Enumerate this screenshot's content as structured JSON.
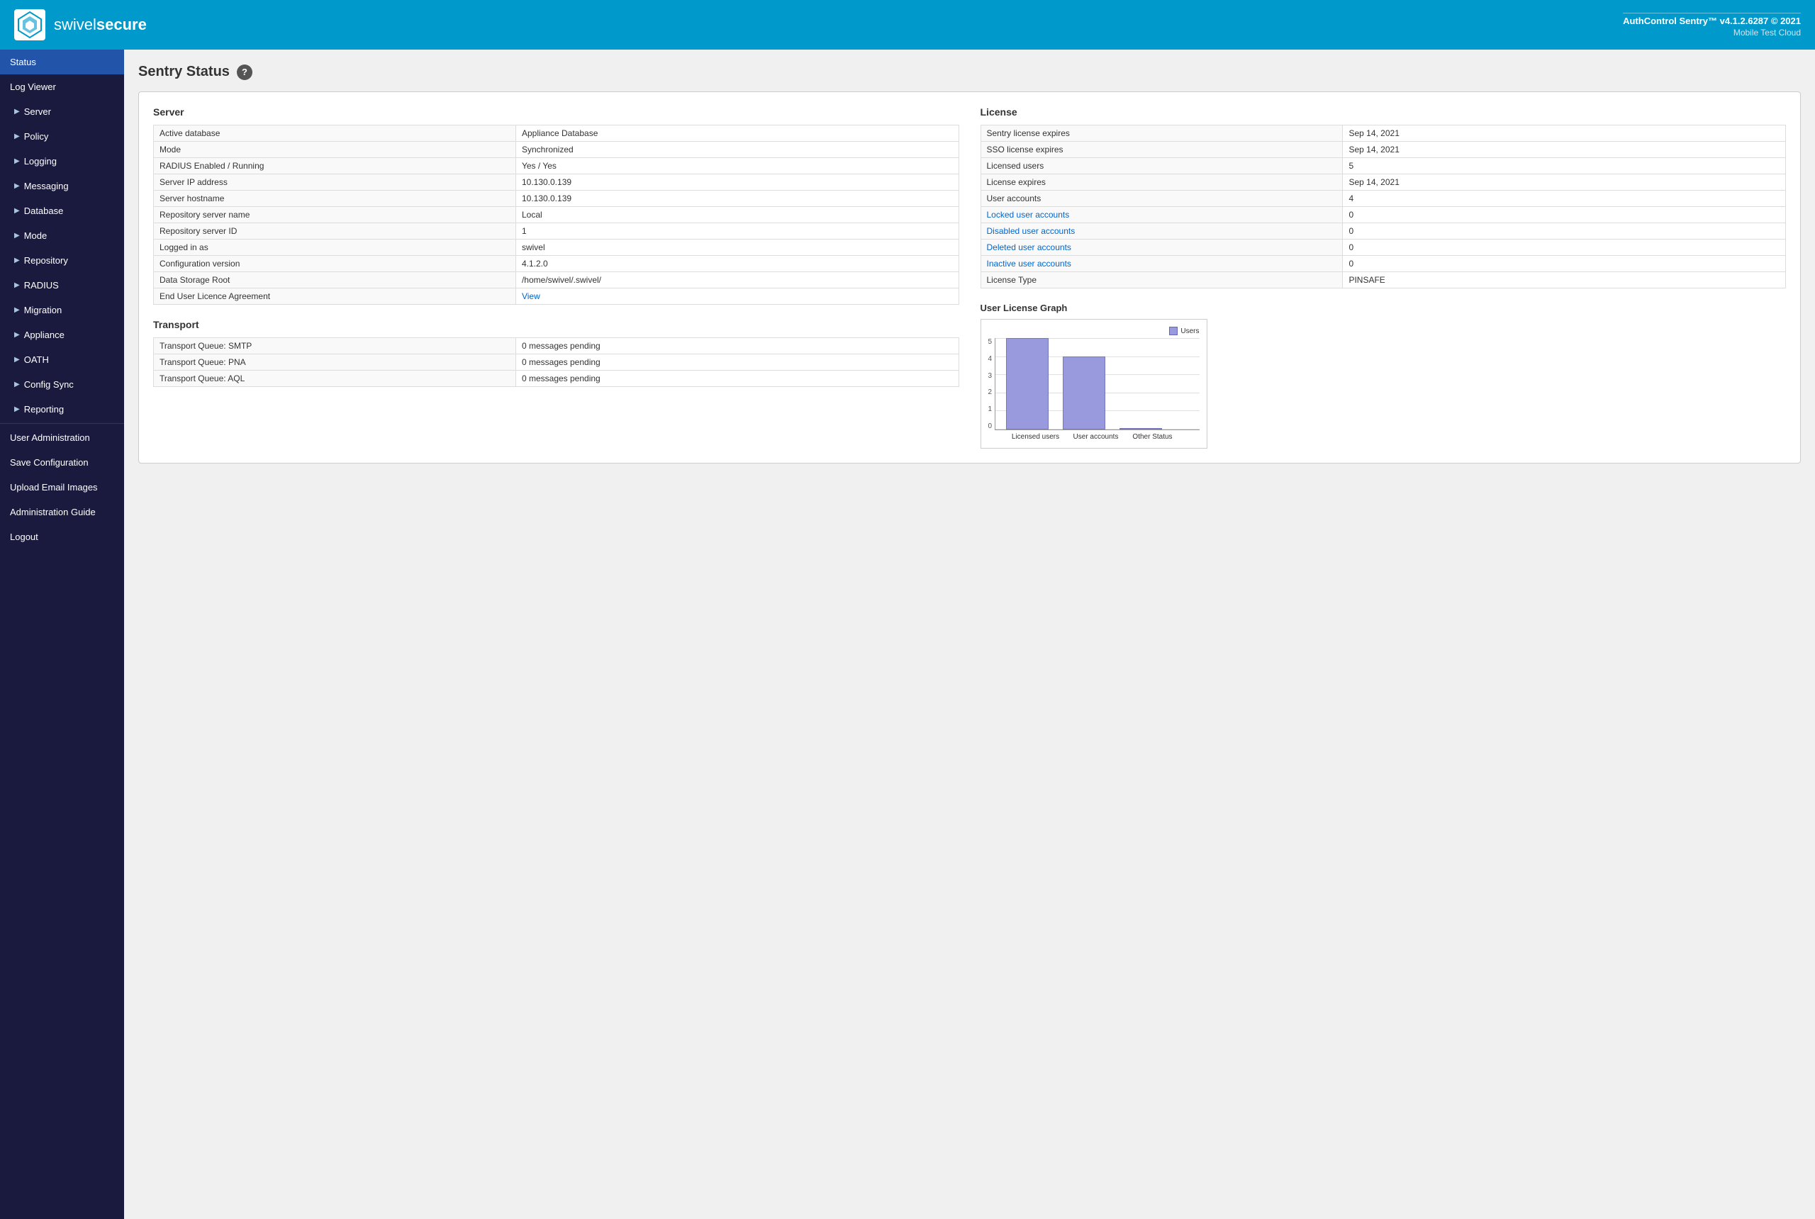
{
  "header": {
    "app_title": "AuthControl Sentry™ v4.1.2.6287 © 2021",
    "cloud_name": "Mobile Test Cloud",
    "logo_text_light": "swivel",
    "logo_text_bold": "secure"
  },
  "sidebar": {
    "items": [
      {
        "id": "status",
        "label": "Status",
        "active": true,
        "level": "top",
        "arrow": false
      },
      {
        "id": "log-viewer",
        "label": "Log Viewer",
        "active": false,
        "level": "top",
        "arrow": false
      },
      {
        "id": "server",
        "label": "Server",
        "active": false,
        "level": "sub",
        "arrow": true
      },
      {
        "id": "policy",
        "label": "Policy",
        "active": false,
        "level": "sub",
        "arrow": true
      },
      {
        "id": "logging",
        "label": "Logging",
        "active": false,
        "level": "sub",
        "arrow": true
      },
      {
        "id": "messaging",
        "label": "Messaging",
        "active": false,
        "level": "sub",
        "arrow": true
      },
      {
        "id": "database",
        "label": "Database",
        "active": false,
        "level": "sub",
        "arrow": true
      },
      {
        "id": "mode",
        "label": "Mode",
        "active": false,
        "level": "sub",
        "arrow": true
      },
      {
        "id": "repository",
        "label": "Repository",
        "active": false,
        "level": "sub",
        "arrow": true
      },
      {
        "id": "radius",
        "label": "RADIUS",
        "active": false,
        "level": "sub",
        "arrow": true
      },
      {
        "id": "migration",
        "label": "Migration",
        "active": false,
        "level": "sub",
        "arrow": true
      },
      {
        "id": "appliance",
        "label": "Appliance",
        "active": false,
        "level": "sub",
        "arrow": true
      },
      {
        "id": "oath",
        "label": "OATH",
        "active": false,
        "level": "sub",
        "arrow": true
      },
      {
        "id": "config-sync",
        "label": "Config Sync",
        "active": false,
        "level": "sub",
        "arrow": true
      },
      {
        "id": "reporting",
        "label": "Reporting",
        "active": false,
        "level": "sub",
        "arrow": true
      },
      {
        "id": "user-administration",
        "label": "User Administration",
        "active": false,
        "level": "top",
        "arrow": false
      },
      {
        "id": "save-configuration",
        "label": "Save Configuration",
        "active": false,
        "level": "top",
        "arrow": false
      },
      {
        "id": "upload-email-images",
        "label": "Upload Email Images",
        "active": false,
        "level": "top",
        "arrow": false
      },
      {
        "id": "administration-guide",
        "label": "Administration Guide",
        "active": false,
        "level": "top",
        "arrow": false
      },
      {
        "id": "logout",
        "label": "Logout",
        "active": false,
        "level": "top",
        "arrow": false
      }
    ]
  },
  "page": {
    "title": "Sentry Status",
    "help_label": "?"
  },
  "server_section": {
    "title": "Server",
    "rows": [
      {
        "label": "Active database",
        "value": "Appliance Database",
        "style": "green"
      },
      {
        "label": "Mode",
        "value": "Synchronized",
        "style": "green"
      },
      {
        "label": "RADIUS Enabled / Running",
        "value": "Yes / Yes",
        "style": "green"
      },
      {
        "label": "Server IP address",
        "value": "10.130.0.139",
        "style": "normal"
      },
      {
        "label": "Server hostname",
        "value": "10.130.0.139",
        "style": "normal"
      },
      {
        "label": "Repository server name",
        "value": "Local",
        "style": "green"
      },
      {
        "label": "Repository server ID",
        "value": "1",
        "style": "green"
      },
      {
        "label": "Logged in as",
        "value": "swivel",
        "style": "green"
      },
      {
        "label": "Configuration version",
        "value": "4.1.2.0",
        "style": "normal"
      },
      {
        "label": "Data Storage Root",
        "value": "/home/swivel/.swivel/",
        "style": "normal"
      },
      {
        "label": "End User Licence Agreement",
        "value": "View",
        "style": "link"
      }
    ]
  },
  "transport_section": {
    "title": "Transport",
    "rows": [
      {
        "label": "Transport Queue: SMTP",
        "value": "0 messages pending",
        "style": "green"
      },
      {
        "label": "Transport Queue: PNA",
        "value": "0 messages pending",
        "style": "green"
      },
      {
        "label": "Transport Queue: AQL",
        "value": "0 messages pending",
        "style": "green"
      }
    ]
  },
  "license_section": {
    "title": "License",
    "rows": [
      {
        "label": "Sentry license expires",
        "value": "Sep 14, 2021",
        "style": "green"
      },
      {
        "label": "SSO license expires",
        "value": "Sep 14, 2021",
        "style": "green"
      },
      {
        "label": "Licensed users",
        "value": "5",
        "style": "normal"
      },
      {
        "label": "License expires",
        "value": "Sep 14, 2021",
        "style": "green"
      },
      {
        "label": "User accounts",
        "value": "4",
        "style": "green"
      },
      {
        "label": "Locked user accounts",
        "value": "0",
        "style": "link"
      },
      {
        "label": "Disabled user accounts",
        "value": "0",
        "style": "link"
      },
      {
        "label": "Deleted user accounts",
        "value": "0",
        "style": "link"
      },
      {
        "label": "Inactive user accounts",
        "value": "0",
        "style": "link"
      },
      {
        "label": "License Type",
        "value": "PINSAFE",
        "style": "normal"
      }
    ]
  },
  "graph": {
    "title": "User License Graph",
    "legend": "Users",
    "y_labels": [
      "5",
      "4",
      "3",
      "2",
      "1",
      "0"
    ],
    "bars": [
      {
        "label": "Licensed users",
        "value": 5,
        "max": 5
      },
      {
        "label": "User accounts",
        "value": 4,
        "max": 5
      },
      {
        "label": "Other Status",
        "value": 0,
        "max": 5
      }
    ]
  }
}
